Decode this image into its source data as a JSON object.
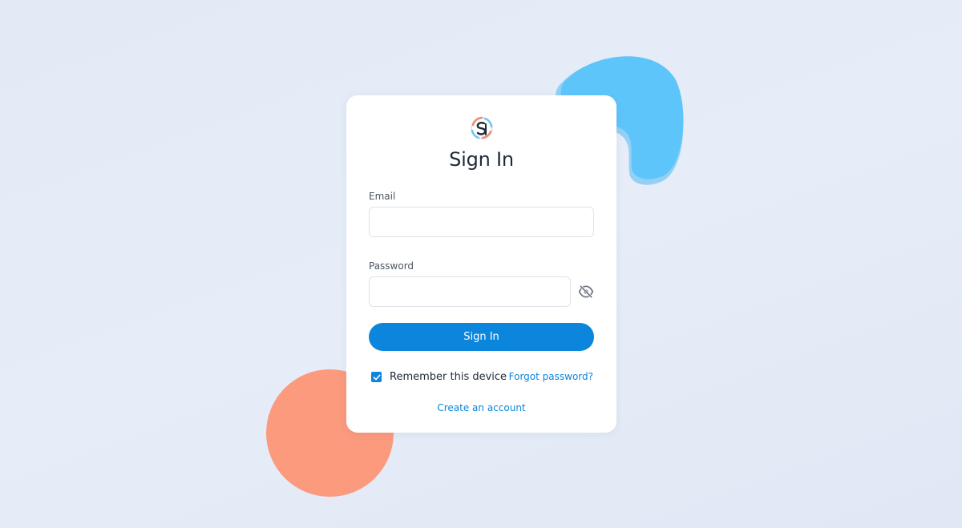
{
  "colors": {
    "background": "#e3ebf7",
    "card": "#ffffff",
    "accent": "#0b86dc",
    "blob_blue": "#5ec5fa",
    "blob_coral": "#fb9a7d"
  },
  "logo": {
    "icon": "sp-swirl-logo-icon"
  },
  "signin": {
    "title": "Sign In",
    "email": {
      "label": "Email",
      "value": "",
      "placeholder": ""
    },
    "password": {
      "label": "Password",
      "value": "",
      "placeholder": "",
      "toggle_icon": "eye-off-icon"
    },
    "button_label": "Sign In",
    "remember": {
      "label": "Remember this device",
      "checked": true
    },
    "forgot_label": "Forgot password?",
    "create_label": "Create an account"
  }
}
